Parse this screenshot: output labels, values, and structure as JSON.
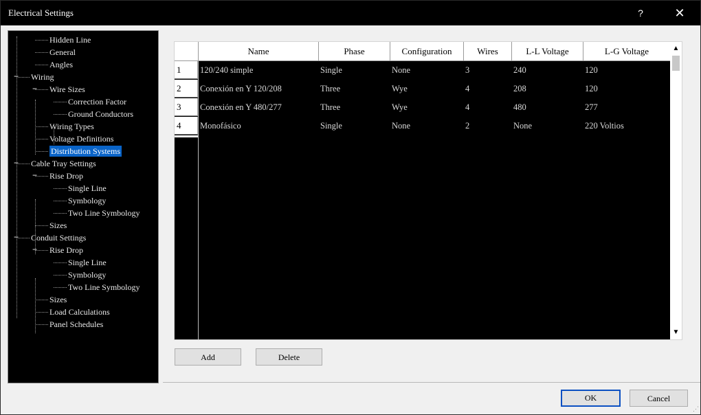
{
  "window": {
    "title": "Electrical Settings",
    "help_label": "?",
    "close_label": "✕"
  },
  "tree": {
    "items": [
      {
        "label": "Hidden Line"
      },
      {
        "label": "General"
      },
      {
        "label": "Angles"
      },
      {
        "label": "Wiring",
        "expander": "−"
      },
      {
        "label": "Wire Sizes",
        "expander": "−"
      },
      {
        "label": "Correction Factor"
      },
      {
        "label": "Ground Conductors"
      },
      {
        "label": "Wiring Types"
      },
      {
        "label": "Voltage Definitions"
      },
      {
        "label": "Distribution Systems",
        "selected": true
      },
      {
        "label": "Cable Tray Settings",
        "expander": "−"
      },
      {
        "label": "Rise Drop",
        "expander": "−"
      },
      {
        "label": "Single Line"
      },
      {
        "label": "Symbology"
      },
      {
        "label": "Two Line Symbology"
      },
      {
        "label": "Sizes"
      },
      {
        "label": "Conduit Settings",
        "expander": "−"
      },
      {
        "label": "Rise Drop",
        "expander": "−"
      },
      {
        "label": "Single Line"
      },
      {
        "label": "Symbology"
      },
      {
        "label": "Two Line Symbology"
      },
      {
        "label": "Sizes"
      },
      {
        "label": "Load Calculations"
      },
      {
        "label": "Panel Schedules"
      }
    ]
  },
  "grid": {
    "columns": [
      "Name",
      "Phase",
      "Configuration",
      "Wires",
      "L-L Voltage",
      "L-G Voltage"
    ],
    "rows": [
      {
        "num": "1",
        "cells": [
          "120/240 simple",
          "Single",
          "None",
          "3",
          "240",
          "120"
        ]
      },
      {
        "num": "2",
        "cells": [
          "Conexión en Y 120/208",
          "Three",
          "Wye",
          "4",
          "208",
          "120"
        ]
      },
      {
        "num": "3",
        "cells": [
          "Conexión en Y 480/277",
          "Three",
          "Wye",
          "4",
          "480",
          "277"
        ]
      },
      {
        "num": "4",
        "cells": [
          "Monofásico",
          "Single",
          "None",
          "2",
          "None",
          "220 Voltios"
        ]
      }
    ]
  },
  "scrollbar": {
    "up": "▲",
    "down": "▼"
  },
  "buttons": {
    "add": "Add",
    "delete": "Delete",
    "ok": "OK",
    "cancel": "Cancel"
  }
}
